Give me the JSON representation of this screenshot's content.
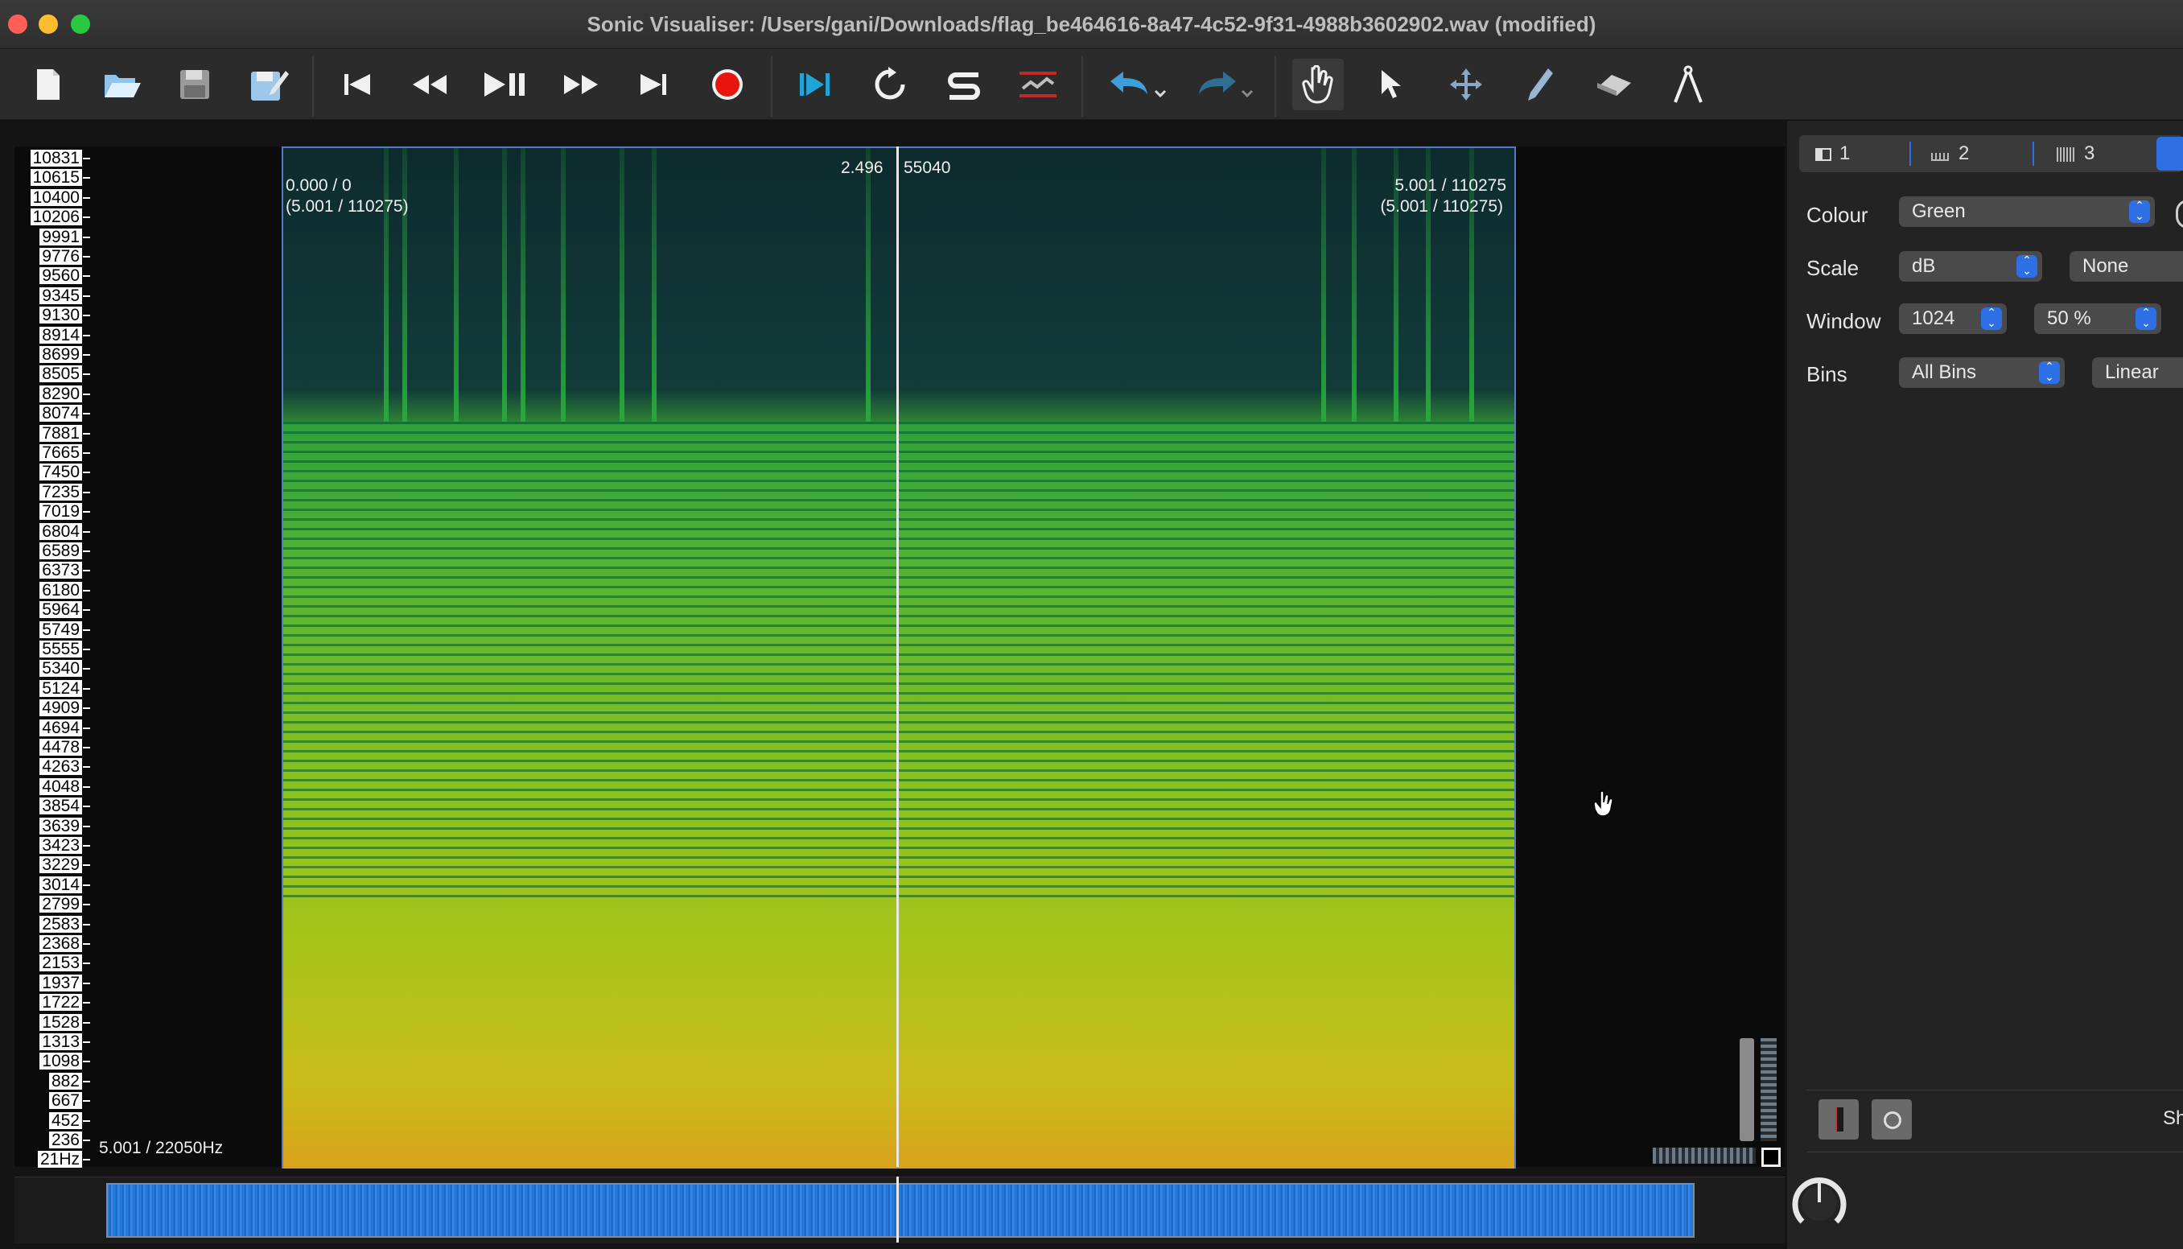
{
  "window": {
    "title": "Sonic Visualiser: /Users/gani/Downloads/flag_be464616-8a47-4c52-9f31-4988b3602902.wav (modified)",
    "colors": {
      "close": "#fe5f57",
      "minimize": "#febc2e",
      "zoom": "#28c840",
      "accent": "#2f6fe6"
    }
  },
  "toolbar": {
    "icons": [
      "new-file-icon",
      "open-file-icon",
      "save-icon",
      "save-as-icon",
      "rewind-start-icon",
      "rewind-icon",
      "play-pause-icon",
      "fast-forward-icon",
      "fast-forward-end-icon",
      "record-icon",
      "play-selection-icon",
      "loop-icon",
      "solo-icon",
      "speed-icon",
      "undo-icon",
      "redo-icon",
      "navigate-tool-icon",
      "select-tool-icon",
      "move-tool-icon",
      "draw-tool-icon",
      "erase-tool-icon",
      "measure-tool-icon"
    ]
  },
  "frequency_scale": {
    "ticks": [
      "10831",
      "10615",
      "10400",
      "10206",
      "9991",
      "9776",
      "9560",
      "9345",
      "9130",
      "8914",
      "8699",
      "8505",
      "8290",
      "8074",
      "7881",
      "7665",
      "7450",
      "7235",
      "7019",
      "6804",
      "6589",
      "6373",
      "6180",
      "5964",
      "5749",
      "5555",
      "5340",
      "5124",
      "4909",
      "4694",
      "4478",
      "4263",
      "4048",
      "3854",
      "3639",
      "3423",
      "3229",
      "3014",
      "2799",
      "2583",
      "2368",
      "2153",
      "1937",
      "1722",
      "1528",
      "1313",
      "1098",
      "882",
      "667",
      "452",
      "236",
      "21Hz"
    ]
  },
  "spectrogram": {
    "start_label": "0.000 / 0",
    "start_sub_label": "(5.001 / 110275)",
    "cursor_time": "2.496",
    "cursor_frame": "55040",
    "end_label": "5.001 / 110275",
    "end_sub_label": "(5.001 / 110275)",
    "bottom_left_label": "5.001 / 22050Hz"
  },
  "panel": {
    "tabs": [
      {
        "label": "1",
        "icon": "pane-icon"
      },
      {
        "label": "2",
        "icon": "spectrum-icon"
      },
      {
        "label": "3",
        "icon": "waveform-icon"
      }
    ],
    "colour_label": "Colour",
    "colour_value": "Green",
    "scale_label": "Scale",
    "scale_value": "dB",
    "normalize_value": "None",
    "window_label": "Window",
    "window_value": "1024",
    "overlap_value": "50 %",
    "bins_label": "Bins",
    "bins_value": "All Bins",
    "bins_scale_value": "Linear",
    "bottom_truncated_label": "Sh"
  }
}
